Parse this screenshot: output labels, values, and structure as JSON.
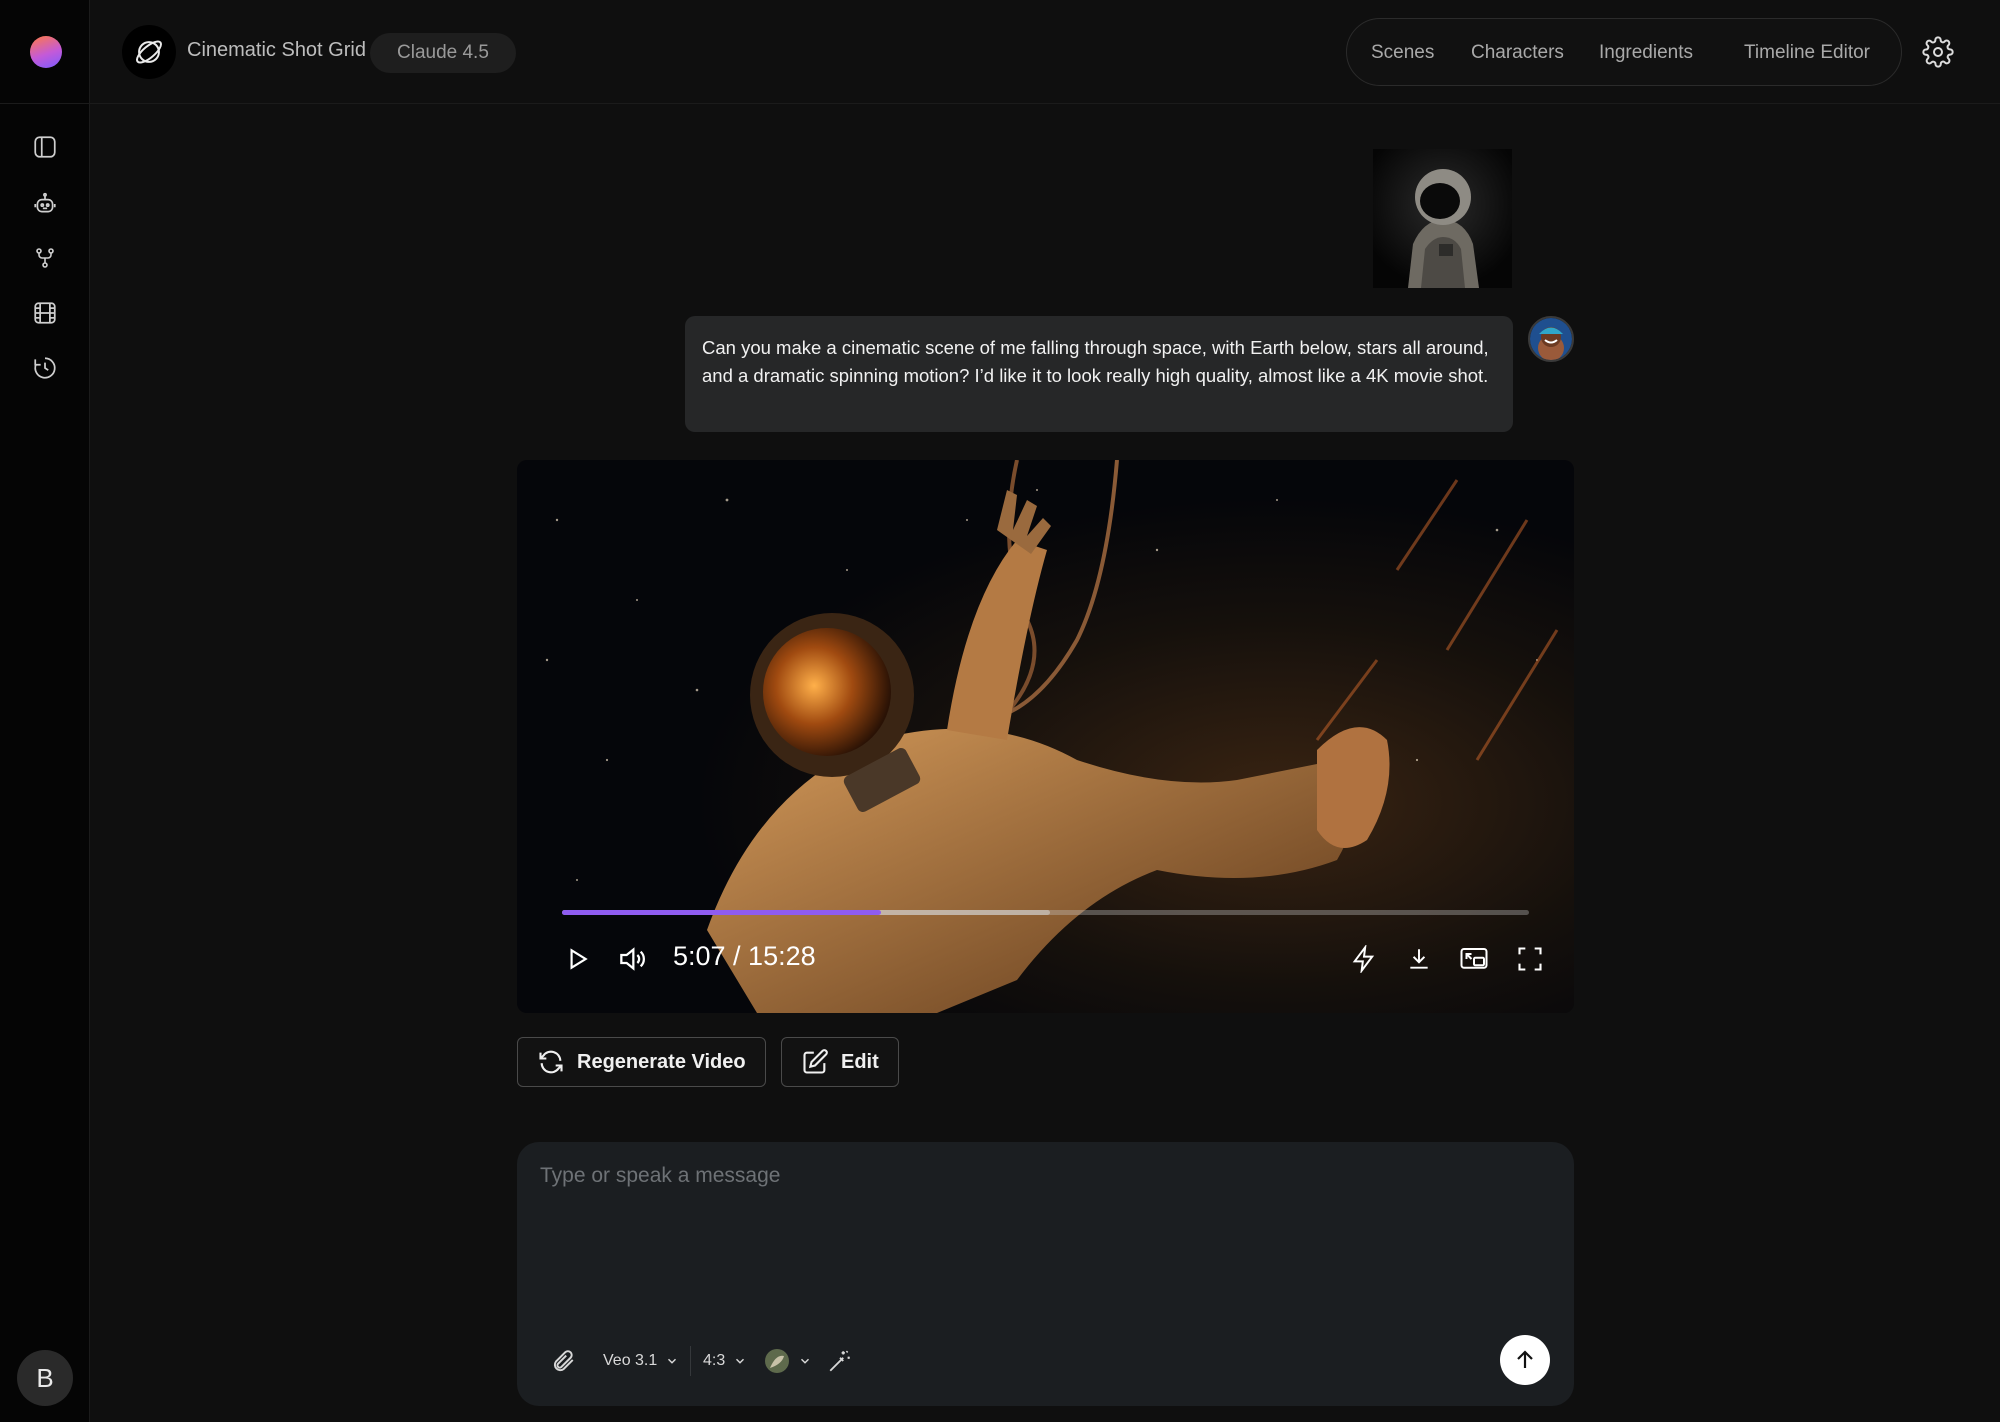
{
  "header": {
    "app_title": "Cinematic Shot Grid",
    "model": "Claude 4.5",
    "nav": [
      "Scenes",
      "Characters",
      "Ingredients",
      "Timeline Editor"
    ],
    "settings_icon": "gear-icon"
  },
  "rail": {
    "icons": [
      "sidebar-toggle-icon",
      "robot-icon",
      "branch-icon",
      "film-icon",
      "history-icon"
    ],
    "user_initial": "B"
  },
  "chat": {
    "user_message": "Can you make a cinematic scene of me falling through space, with Earth below, stars all around, and a dramatic spinning motion? I’d like it to look really high quality, almost like a 4K movie shot."
  },
  "video": {
    "time": "5:07 / 15:28",
    "played_fraction": 0.33,
    "buffered_fraction": 0.505,
    "accent_color": "#8f5cf0"
  },
  "actions": {
    "regenerate": "Regenerate Video",
    "edit": "Edit"
  },
  "composer": {
    "placeholder": "Type or speak a message",
    "model": "Veo 3.1",
    "aspect": "4:3"
  }
}
